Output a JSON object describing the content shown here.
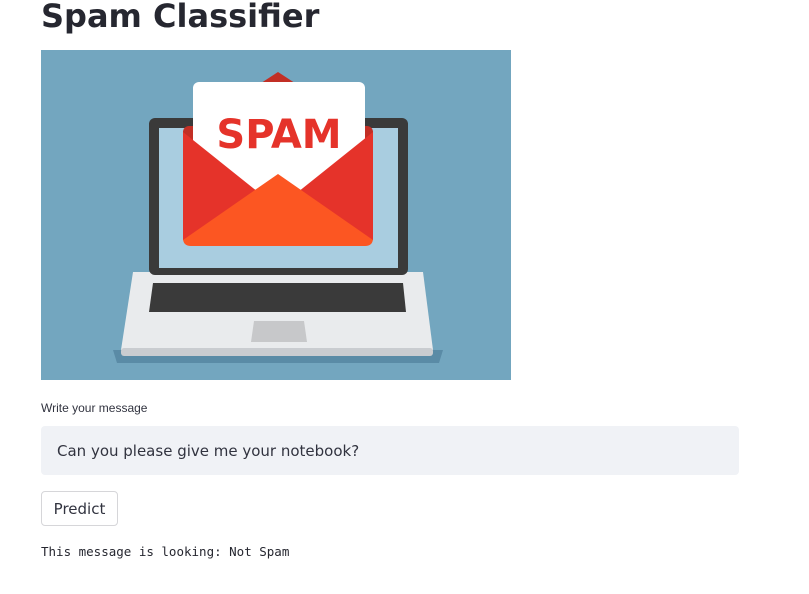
{
  "page": {
    "title": "Spam Classifier"
  },
  "hero_image": {
    "icon": "spam-email-laptop-illustration",
    "envelope_text": "SPAM",
    "colors": {
      "background": "#73a6bf",
      "envelope_red": "#e5332a",
      "envelope_orange": "#fc5622",
      "laptop_frame": "#3a3a3a",
      "screen": "#a9cde0"
    }
  },
  "message_input": {
    "label": "Write your message",
    "value": "Can you please give me your notebook?"
  },
  "predict": {
    "label": "Predict"
  },
  "result": {
    "text": "This message is looking: Not Spam"
  }
}
